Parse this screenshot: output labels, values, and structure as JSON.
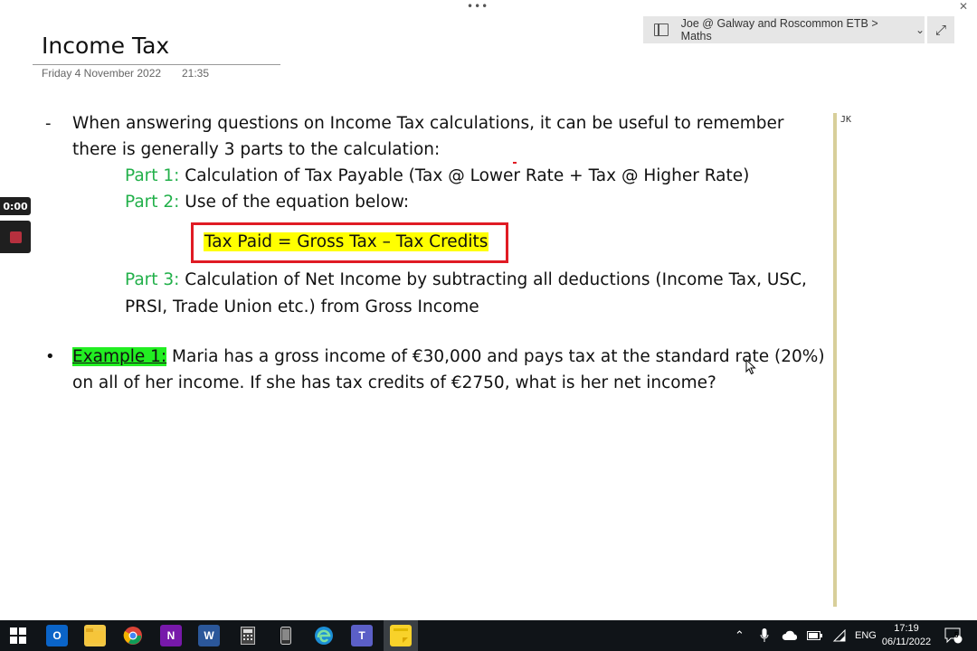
{
  "window": {
    "dots": "•••",
    "close": "✕"
  },
  "breadcrumb": {
    "text": "Joe @ Galway and Roscommon ETB > Maths",
    "chevron": "⌄",
    "expand": "⤢"
  },
  "page": {
    "title": "Income Tax",
    "date": "Friday 4 November 2022",
    "time": "21:35"
  },
  "recorder": {
    "elapsed": "0:00"
  },
  "content": {
    "dash": "-",
    "intro_line1": "When answering questions on Income Tax calculations, it can be useful to remember",
    "intro_line2": "there is generally 3 parts to the calculation:",
    "part1_label": "Part 1:",
    "part1_text": " Calculation of Tax Payable (Tax @ Lower Rate + Tax @ Higher Rate)",
    "part2_label": "Part 2:",
    "part2_text": " Use of the equation below:",
    "formula": "Tax Paid = Gross Tax – Tax Credits",
    "part3_label": "Part 3:",
    "part3_text": " Calculation of Net Income by subtracting all deductions (Income Tax, USC,",
    "part3_line2": "PRSI, Trade Union etc.) from Gross Income",
    "bullet": "•",
    "example_label": "Example 1:",
    "example_text": " Maria has a gross income of €30,000 and pays tax at the standard rate (20%)",
    "example_line2": "on all of her income. If she has tax credits of €2750, what is her net income?"
  },
  "margin": {
    "initials": "JK"
  },
  "taskbar": {
    "apps": [
      "windows-start",
      "outlook",
      "file-explorer",
      "chrome",
      "onenote",
      "word",
      "calculator",
      "phone",
      "edge",
      "teams",
      "sticky-notes"
    ],
    "language": "ENG",
    "clock_time": "17:19",
    "clock_date": "06/11/2022",
    "notifications": "5"
  },
  "colors": {
    "accent_green": "#22b04a",
    "highlight_yellow": "#ffff00",
    "highlight_green": "#22ee22",
    "box_red": "#e01b24"
  }
}
